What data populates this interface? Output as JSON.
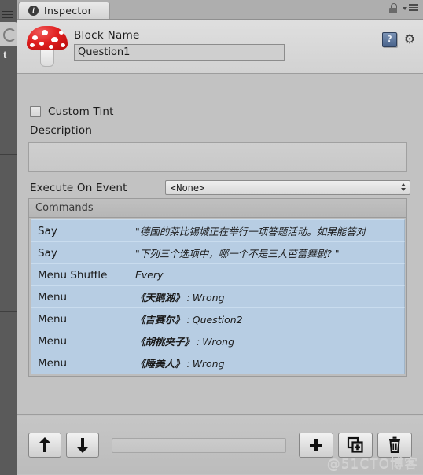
{
  "window": {
    "tab_label": "Inspector",
    "tab_icon": "info-circle-icon",
    "lock_icon": "lock-open-icon",
    "menu_icon": "panel-menu-icon"
  },
  "object_header": {
    "component_icon": "fungus-mushroom-icon",
    "block_name_label": "Block Name",
    "block_name_value": "Question1",
    "help_icon": "help-book-icon",
    "gear_icon": "settings-gear-icon"
  },
  "properties": {
    "custom_tint_label": "Custom Tint",
    "custom_tint_checked": false,
    "description_label": "Description",
    "description_value": "",
    "execute_on_event_label": "Execute On Event",
    "execute_on_event_value": "<None>"
  },
  "commands": {
    "header": "Commands",
    "rows": [
      {
        "type": "Say",
        "summary": "\"德国的莱比锡城正在举行一项答题活动。如果能答对",
        "bold": false,
        "value": "",
        "sep": ""
      },
      {
        "type": "Say",
        "summary": "\"下列三个选项中，哪一个不是三大芭蕾舞剧? \"",
        "bold": false,
        "value": "",
        "sep": ""
      },
      {
        "type": "Menu Shuffle",
        "summary": "Every",
        "bold": false,
        "value": "",
        "sep": ""
      },
      {
        "type": "Menu",
        "summary": "《天鹅湖》",
        "bold": true,
        "value": "Wrong",
        "sep": ":"
      },
      {
        "type": "Menu",
        "summary": "《吉赛尔》",
        "bold": true,
        "value": "Question2",
        "sep": ":"
      },
      {
        "type": "Menu",
        "summary": "《胡桃夹子》",
        "bold": true,
        "value": "Wrong",
        "sep": ":"
      },
      {
        "type": "Menu",
        "summary": "《睡美人》",
        "bold": true,
        "value": "Wrong",
        "sep": ":"
      }
    ]
  },
  "toolbar": {
    "move_up_icon": "arrow-up-icon",
    "move_down_icon": "arrow-down-icon",
    "search_value": "",
    "add_icon": "plus-icon",
    "duplicate_icon": "duplicate-icon",
    "delete_icon": "trash-icon"
  },
  "gutter": {
    "hamburger_icon": "hamburger-icon",
    "tab_icon": "scene-view-icon",
    "label": "t"
  },
  "watermark": "@51CTO博客"
}
